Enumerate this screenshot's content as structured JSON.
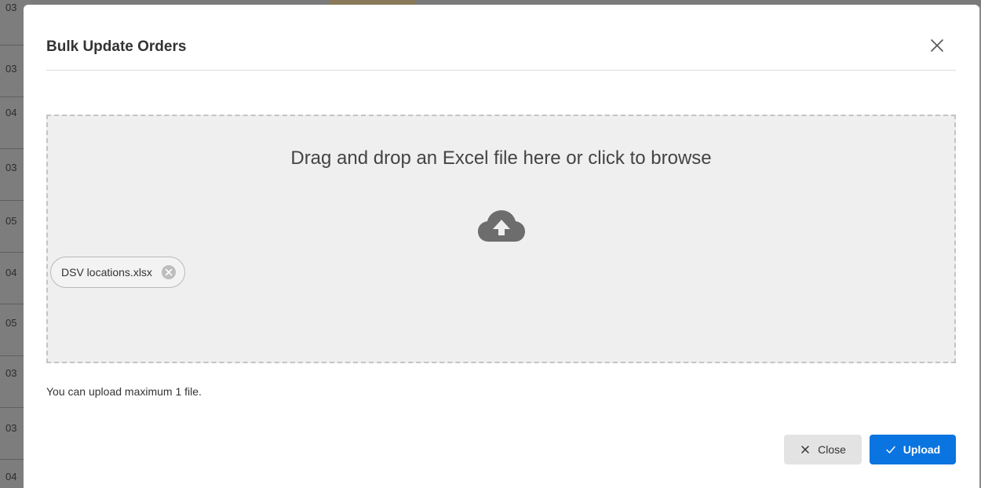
{
  "background": {
    "row_numbers": [
      "03",
      "03",
      "04",
      "03",
      "05",
      "04",
      "05",
      "03",
      "03",
      "04"
    ]
  },
  "modal": {
    "title": "Bulk Update Orders",
    "dropzone": {
      "instruction": "Drag and drop an Excel file here or click to browse",
      "icon": "cloud-upload-icon"
    },
    "files": [
      {
        "name": "DSV locations.xlsx"
      }
    ],
    "hint": "You can upload maximum 1 file.",
    "buttons": {
      "close_label": "Close",
      "upload_label": "Upload"
    },
    "colors": {
      "primary": "#0a74e0",
      "secondary_button": "#e3e3e3",
      "dropzone_bg": "#efefef"
    }
  }
}
